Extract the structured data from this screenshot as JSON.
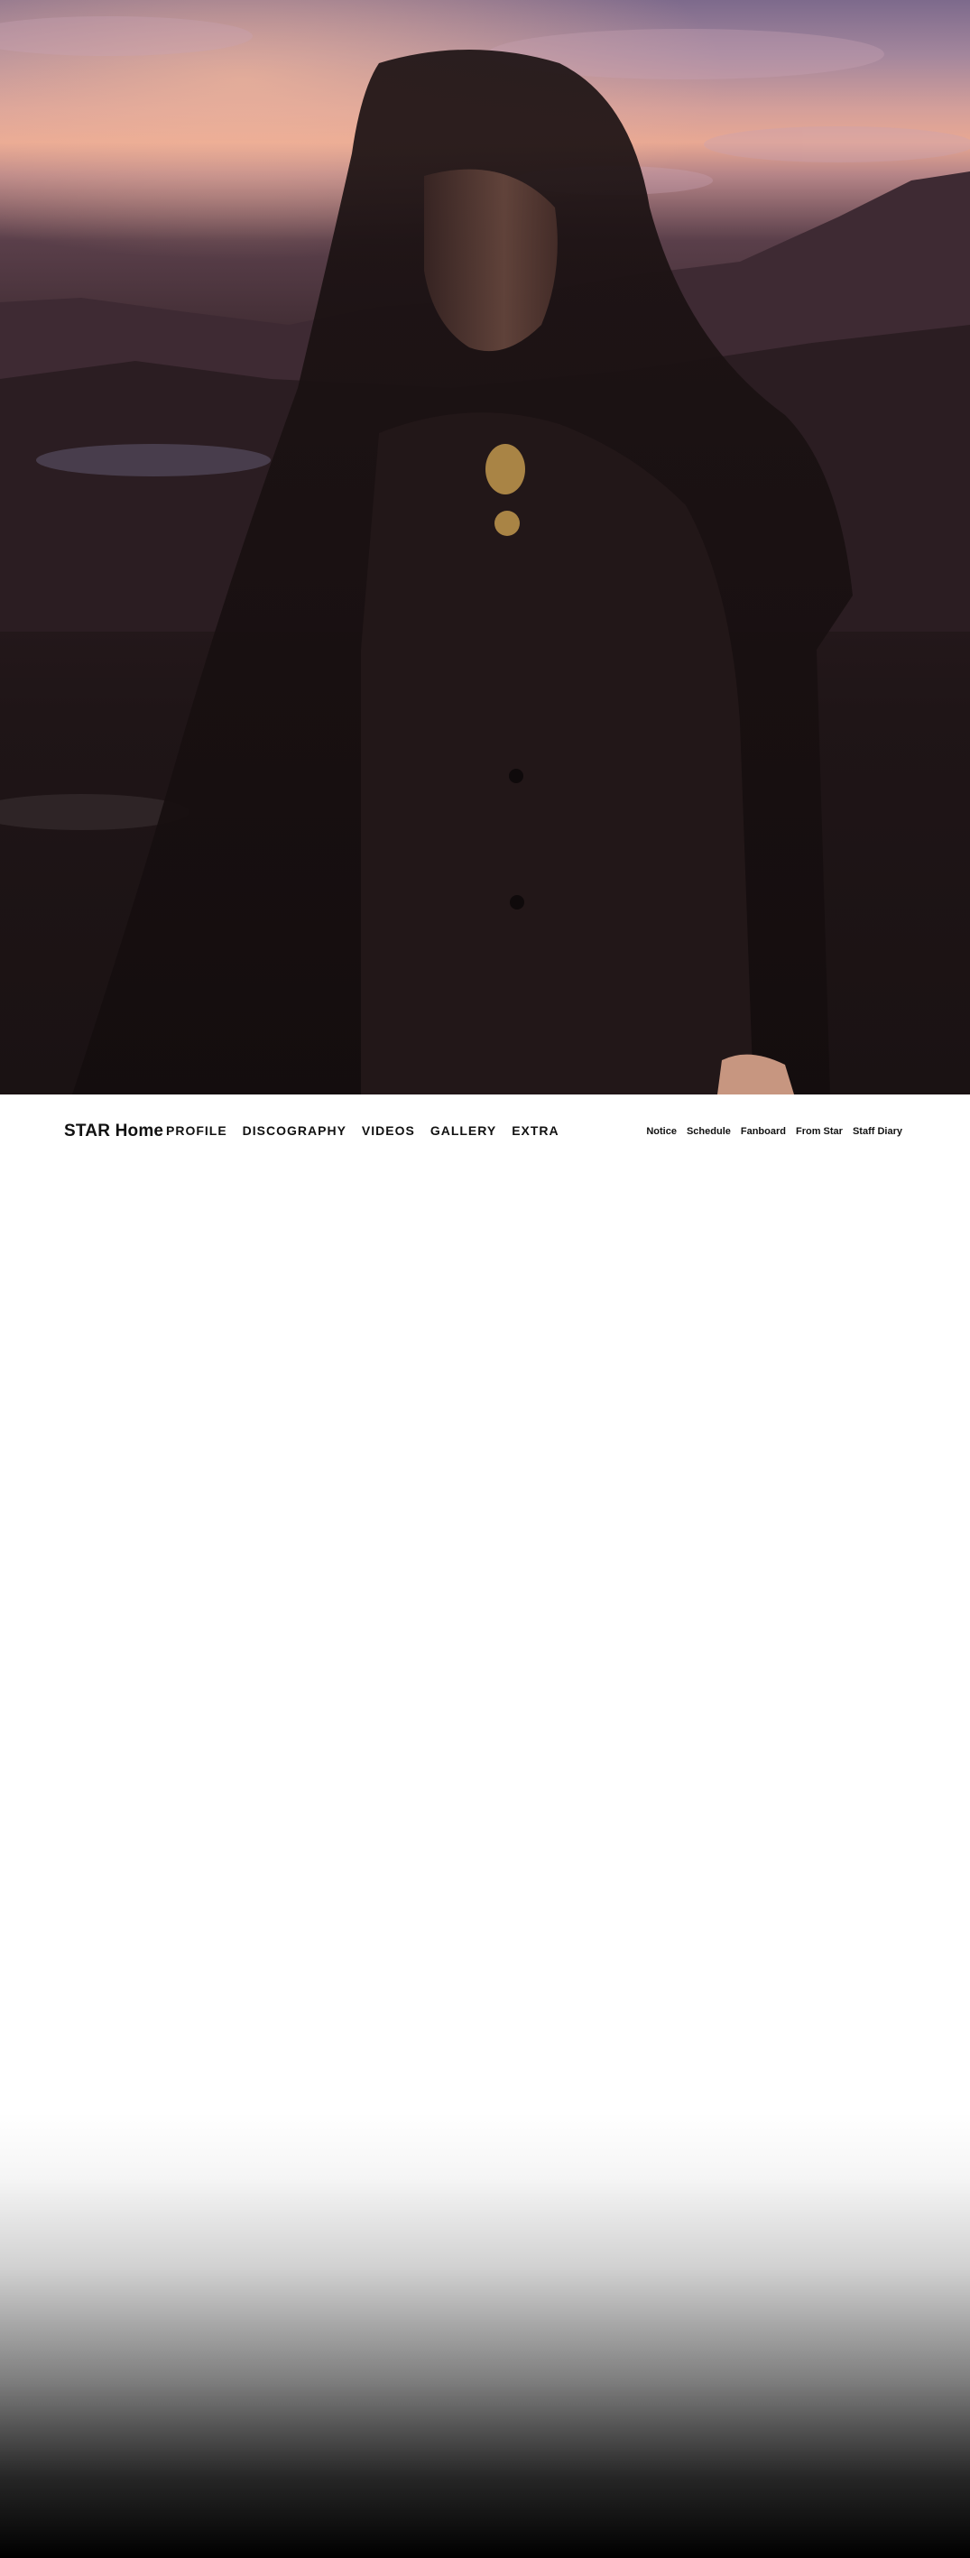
{
  "hero": {
    "image_description": "",
    "colors": {
      "sky_top": "#7d6a8c",
      "sky_glow": "#e8a893",
      "mountains": "#3d2a30",
      "suit": "#221718"
    }
  },
  "nav": {
    "brand": "STAR Home",
    "main_menu": [
      {
        "label": "PROFILE"
      },
      {
        "label": "DISCOGRAPHY"
      },
      {
        "label": "VIDEOS"
      },
      {
        "label": "GALLERY"
      },
      {
        "label": "EXTRA"
      }
    ],
    "sub_menu": [
      {
        "label": "Notice"
      },
      {
        "label": "Schedule"
      },
      {
        "label": "Fanboard"
      },
      {
        "label": "From Star"
      },
      {
        "label": "Staff Diary"
      }
    ]
  }
}
